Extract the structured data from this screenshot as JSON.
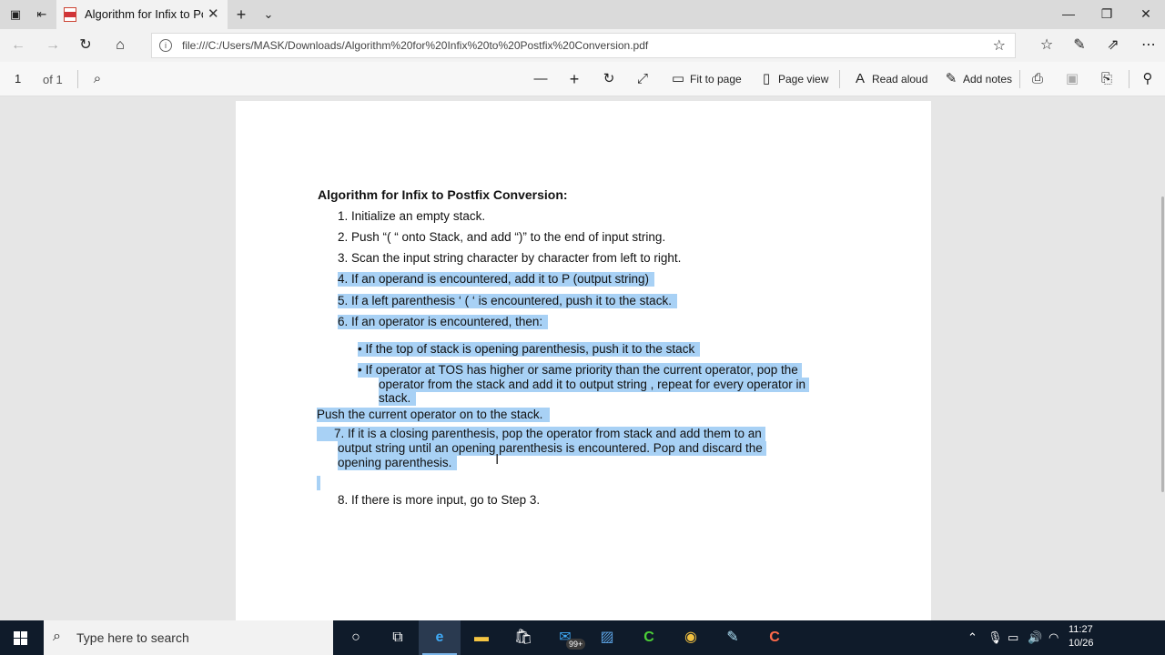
{
  "browser": {
    "tab_title": "Algorithm for Infix to Pc",
    "url": "file:///C:/Users/MASK/Downloads/Algorithm%20for%20Infix%20to%20Postfix%20Conversion.pdf"
  },
  "pdf_toolbar": {
    "page_number": "1",
    "page_count": "of 1",
    "fit_to_page": "Fit to page",
    "page_view": "Page view",
    "read_aloud": "Read aloud",
    "add_notes": "Add notes"
  },
  "document": {
    "title": "Algorithm for Infix to Postfix Conversion:",
    "step1": "1. Initialize an empty stack.",
    "step2": "2. Push “( “ onto Stack, and add “)” to the end of input string.",
    "step3": "3. Scan the input string character by character from left to right.",
    "step4": "4. If an operand is encountered, add it to P (output string)",
    "step5": "5. If a left parenthesis ‘ ( ‘ is encountered, push it to the stack.",
    "step6": "6. If an operator is encountered, then:",
    "bullet1": "• If the top of stack is opening parenthesis, push it to the stack",
    "bullet2_l1": "• If operator at TOS has higher or same priority than the current operator, pop  the",
    "bullet2_l2": "operator from the stack and add it to output string , repeat for every  operator in",
    "bullet2_l3": "stack.",
    "push_line": "Push the current operator on to the stack.",
    "step7_l1": "7. If it is a closing parenthesis, pop the operator from stack and add them to an",
    "step7_l2": "output  string until an opening parenthesis is encountered. Pop and discard the",
    "step7_l3": "opening  parenthesis.",
    "step8": "8. If there is more input, go to Step 3."
  },
  "taskbar": {
    "search_placeholder": "Type here to search",
    "mail_badge": "99+",
    "clock_time": "11:27",
    "clock_date": "10/26"
  },
  "colors": {
    "selection": "#a8d1f5",
    "taskbar": "#0f1b2a"
  }
}
